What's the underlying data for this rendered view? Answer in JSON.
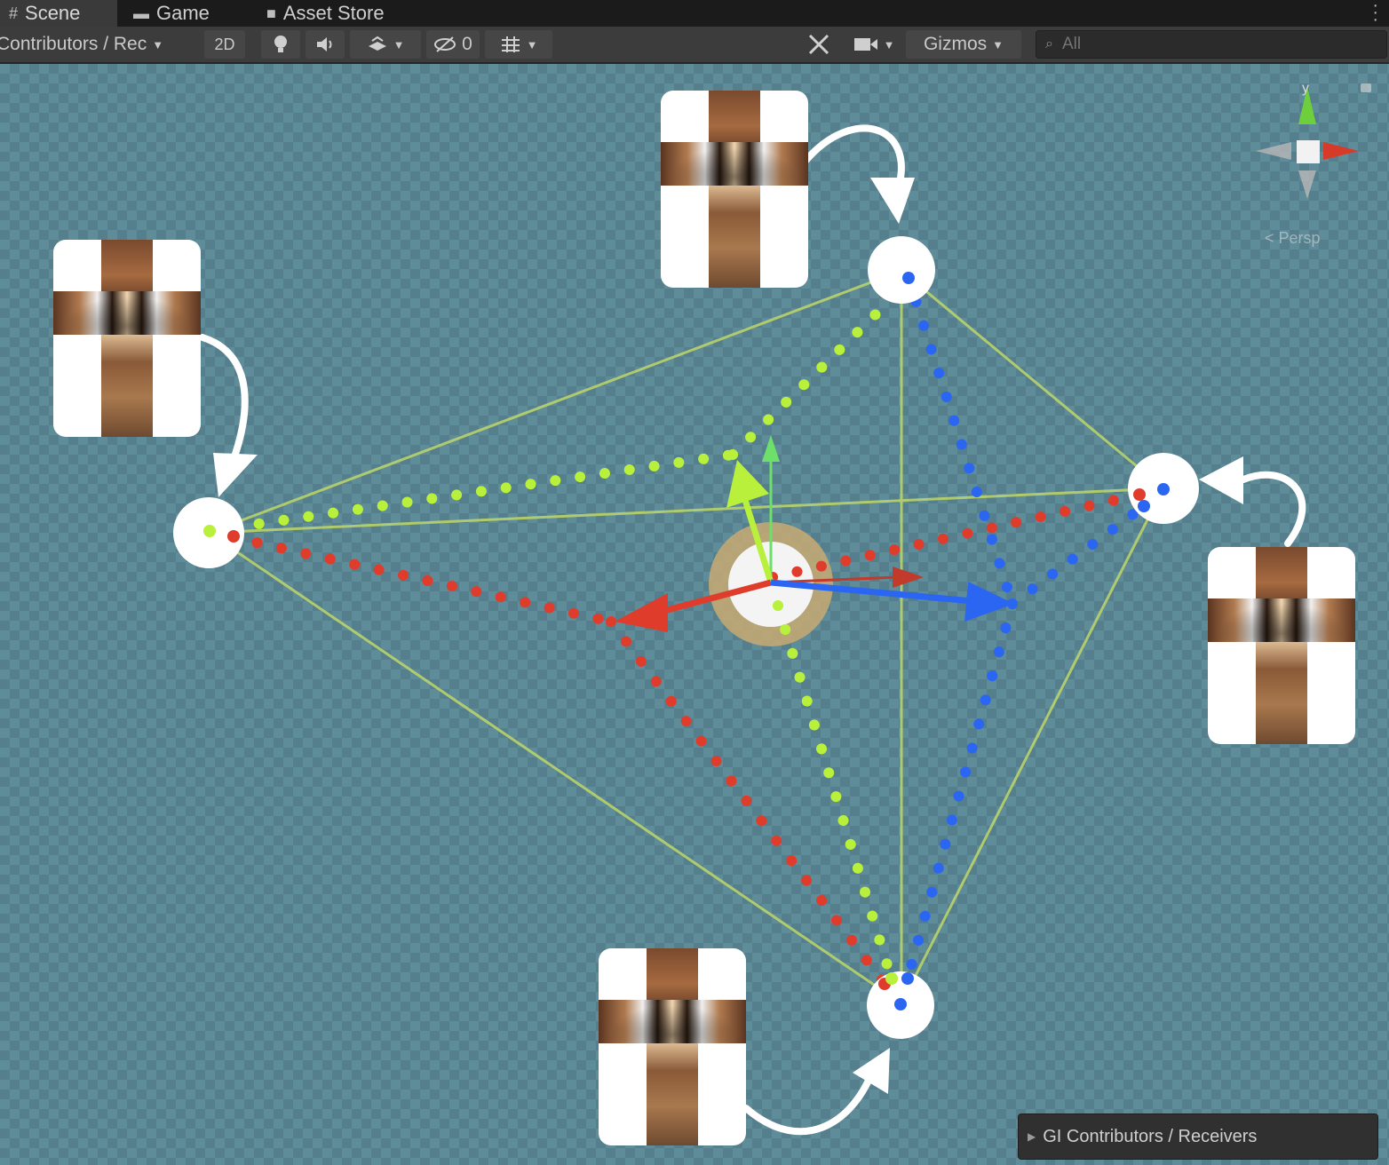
{
  "tabs": [
    {
      "label": "Scene",
      "icon": "hash-icon",
      "active": true
    },
    {
      "label": "Game",
      "icon": "gamepad-icon",
      "active": false
    },
    {
      "label": "Asset Store",
      "icon": "bag-icon",
      "active": false
    }
  ],
  "toolbar": {
    "draw_mode": "Contributors / Rec",
    "mode_2d": "2D",
    "hidden_count": "0",
    "gizmos": "Gizmos",
    "search_placeholder": "All"
  },
  "viewport": {
    "background_color": "#5e8c99",
    "colors": {
      "red": "#e03c2c",
      "green": "#b8f03c",
      "blue": "#2a66f2",
      "edge": "#b9d36a"
    },
    "gizmo": {
      "axis_label": "y",
      "projection": "< Persp"
    }
  },
  "overlay": {
    "label": "GI Contributors / Receivers"
  }
}
